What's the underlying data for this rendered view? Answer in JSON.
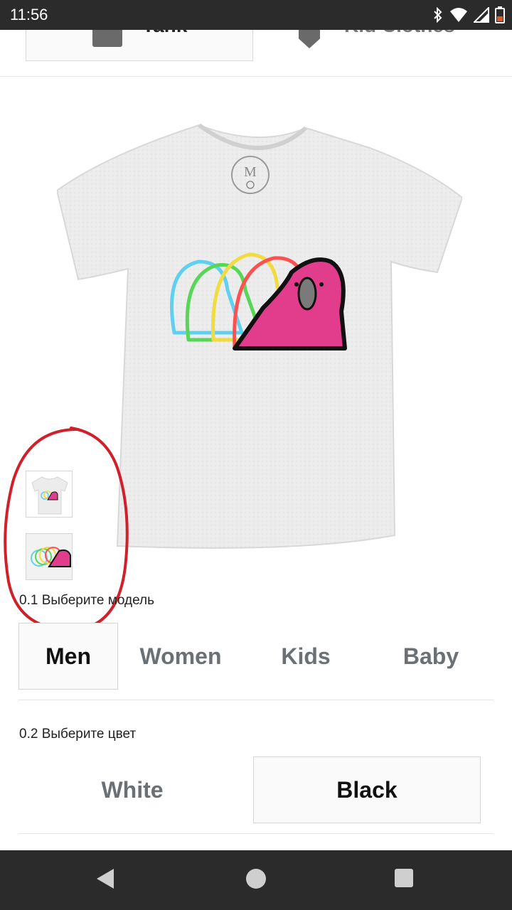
{
  "status_bar": {
    "time": "11:56",
    "icons": [
      "bluetooth-icon",
      "wifi-icon",
      "signal-icon",
      "battery-icon"
    ]
  },
  "category_row": {
    "items": [
      {
        "label": "Tank",
        "icon": "tank-icon"
      },
      {
        "label": "Kid Clothes",
        "icon": "kid-clothes-icon"
      }
    ]
  },
  "product": {
    "thumbnails": [
      "thumbnail-front",
      "thumbnail-design"
    ]
  },
  "model_step": {
    "label": "0.1 Выберите модель",
    "options": [
      "Men",
      "Women",
      "Kids",
      "Baby"
    ],
    "selected": "Men"
  },
  "color_step": {
    "label": "0.2 Выберите цвет",
    "options": [
      "White",
      "Black"
    ],
    "selected": "Black"
  },
  "colors": {
    "annotation_red": "#d0202a",
    "parrot_pink": "#e23c8c",
    "shirt": "#ececec"
  }
}
